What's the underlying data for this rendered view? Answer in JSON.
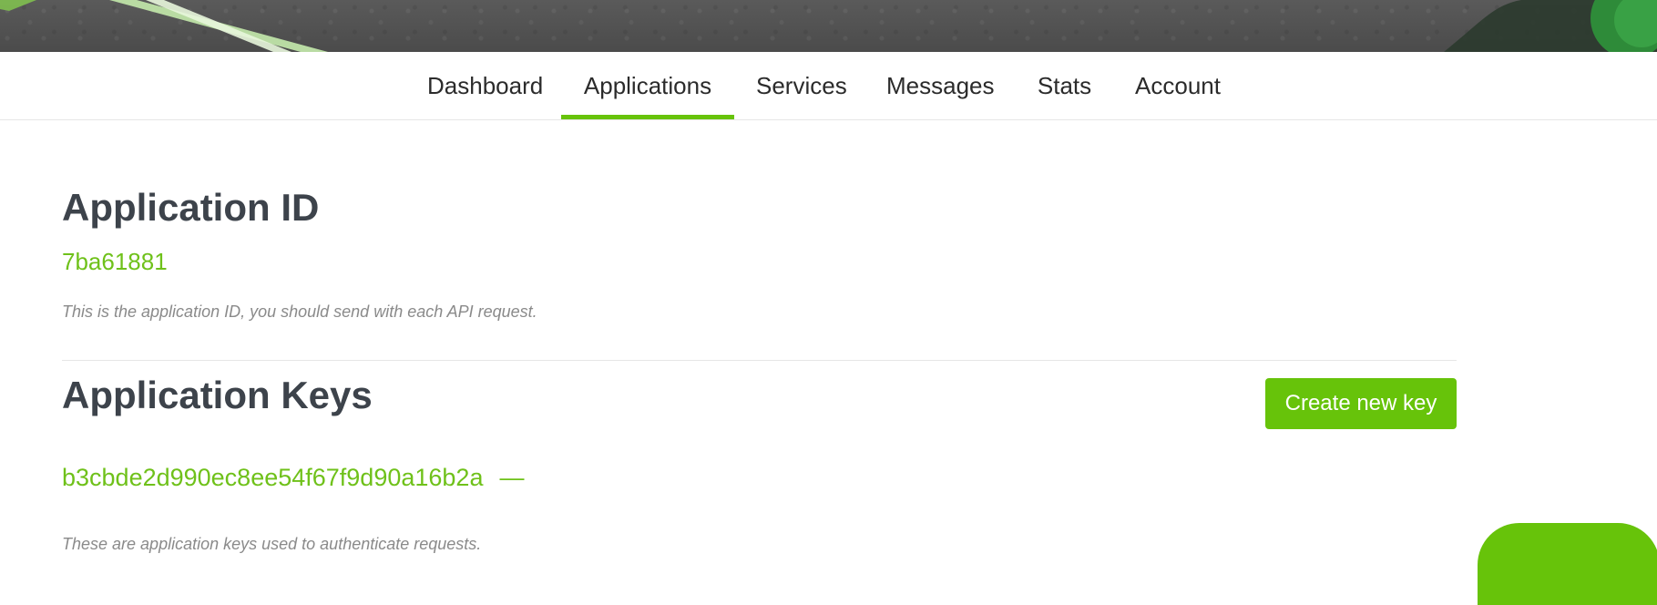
{
  "nav": {
    "items": [
      {
        "label": "Dashboard",
        "active": false
      },
      {
        "label": "Applications",
        "active": true
      },
      {
        "label": "Services",
        "active": false
      },
      {
        "label": "Messages",
        "active": false
      },
      {
        "label": "Stats",
        "active": false
      },
      {
        "label": "Account",
        "active": false
      }
    ]
  },
  "section_id": {
    "title": "Application ID",
    "value": "7ba61881",
    "hint": "This is the application ID, you should send with each API request."
  },
  "section_keys": {
    "title": "Application Keys",
    "create_button_label": "Create new key",
    "keys": [
      {
        "value": "b3cbde2d990ec8ee54f67f9d90a16b2a",
        "action_glyph": "—"
      }
    ],
    "hint": "These are application keys used to authenticate requests."
  },
  "colors": {
    "accent": "#67c30a",
    "heading": "#3d434b",
    "hint": "#8a8a8a"
  }
}
